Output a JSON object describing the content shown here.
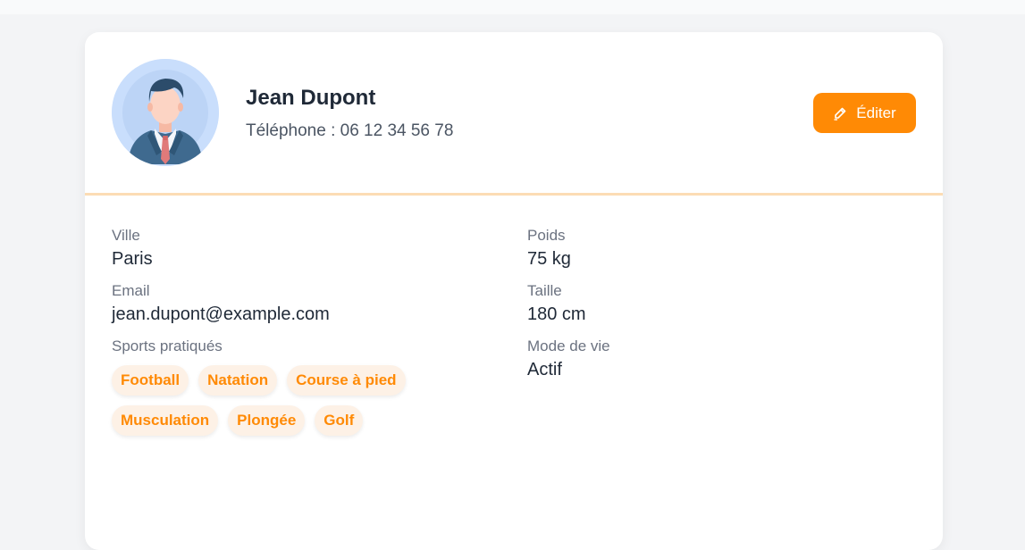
{
  "profile": {
    "name": "Jean Dupont",
    "phone": "Téléphone : 06 12 34 56 78",
    "edit_label": "Éditer"
  },
  "fields_left": {
    "city_label": "Ville",
    "city_value": "Paris",
    "email_label": "Email",
    "email_value": "jean.dupont@example.com",
    "sports_label": "Sports pratiqués"
  },
  "fields_right": {
    "weight_label": "Poids",
    "weight_value": "75 kg",
    "height_label": "Taille",
    "height_value": "180 cm",
    "lifestyle_label": "Mode de vie",
    "lifestyle_value": "Actif"
  },
  "sports": [
    "Football",
    "Natation",
    "Course à pied",
    "Musculation",
    "Plongée",
    "Golf"
  ],
  "colors": {
    "accent": "#ff8a05",
    "tag_bg": "#fdf1e6",
    "divider": "#fcdcb4"
  },
  "icons": {
    "edit": "pencil-icon",
    "avatar": "businessman-avatar"
  }
}
